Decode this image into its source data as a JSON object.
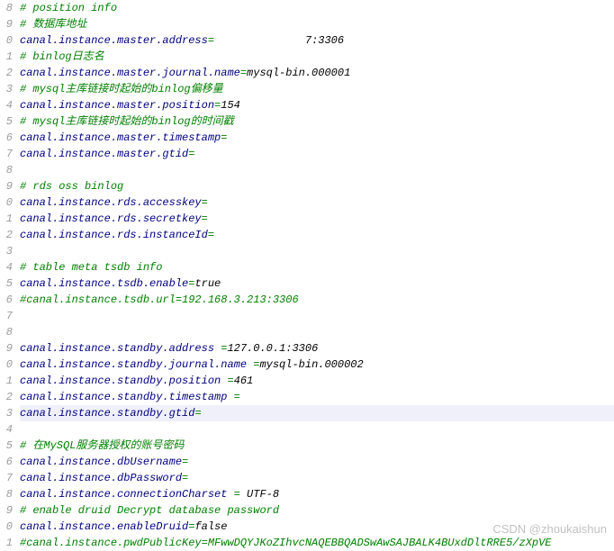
{
  "gutter": [
    "8",
    "9",
    "0",
    "1",
    "2",
    "3",
    "4",
    "5",
    "6",
    "7",
    "8",
    "9",
    "0",
    "1",
    "2",
    "3",
    "4",
    "5",
    "6",
    "7",
    "8",
    "9",
    "0",
    "1",
    "2",
    "3",
    "4",
    "5",
    "6",
    "7",
    "8",
    "9",
    "0",
    "1"
  ],
  "lines": [
    {
      "comment": "# position info"
    },
    {
      "comment": "# 数据库地址"
    },
    {
      "key": "canal.instance.master.address",
      "eq": "=",
      "val_hidden": "              ",
      "val2": "7:3306"
    },
    {
      "comment": "# binlog日志名"
    },
    {
      "key": "canal.instance.master.journal.name",
      "eq": "=",
      "val": "mysql-bin.000001"
    },
    {
      "comment": "# mysql主库链接时起始的binlog偏移量"
    },
    {
      "key": "canal.instance.master.position",
      "eq": "=",
      "val": "154"
    },
    {
      "comment": "# mysql主库链接时起始的binlog的时间戳"
    },
    {
      "key": "canal.instance.master.timestamp",
      "eq": "=",
      "val": ""
    },
    {
      "key": "canal.instance.master.gtid",
      "eq": "=",
      "val": ""
    },
    {
      "blank": true
    },
    {
      "comment": "# rds oss binlog"
    },
    {
      "key": "canal.instance.rds.accesskey",
      "eq": "=",
      "val": ""
    },
    {
      "key": "canal.instance.rds.secretkey",
      "eq": "=",
      "val": ""
    },
    {
      "key": "canal.instance.rds.instanceId",
      "eq": "=",
      "val": ""
    },
    {
      "blank": true
    },
    {
      "comment": "# table meta tsdb info"
    },
    {
      "key": "canal.instance.tsdb.enable",
      "eq": "=",
      "val": "true"
    },
    {
      "comment": "#canal.instance.tsdb.url=192.168.3.213:3306"
    },
    {
      "blank": true
    },
    {
      "blank": true
    },
    {
      "key": "canal.instance.standby.address ",
      "eq": "=",
      "val": "127.0.0.1:3306"
    },
    {
      "key": "canal.instance.standby.journal.name ",
      "eq": "=",
      "val": "mysql-bin.000002"
    },
    {
      "key": "canal.instance.standby.position ",
      "eq": "=",
      "val": "461"
    },
    {
      "key": "canal.instance.standby.timestamp ",
      "eq": "=",
      "val": ""
    },
    {
      "key": "canal.instance.standby.gtid",
      "eq": "=",
      "val": "",
      "hl": true
    },
    {
      "blank": true
    },
    {
      "comment": "# 在MySQL服务器授权的账号密码"
    },
    {
      "key": "canal.instance.dbUsername",
      "eq": "=",
      "val_hidden": " "
    },
    {
      "key": "canal.instance.dbPassword",
      "eq": "=",
      "val_hidden": " "
    },
    {
      "key": "canal.instance.connectionCharset ",
      "eq": "= ",
      "val": "UTF-8"
    },
    {
      "comment": "# enable druid Decrypt database password"
    },
    {
      "key": "canal.instance.enableDruid",
      "eq": "=",
      "val": "false"
    },
    {
      "comment": "#canal.instance.pwdPublicKey=MFwwDQYJKoZIhvcNAQEBBQADSwAwSAJBALK4BUxdDltRRE5/zXpVE"
    }
  ],
  "watermark": "CSDN @zhoukaishun"
}
